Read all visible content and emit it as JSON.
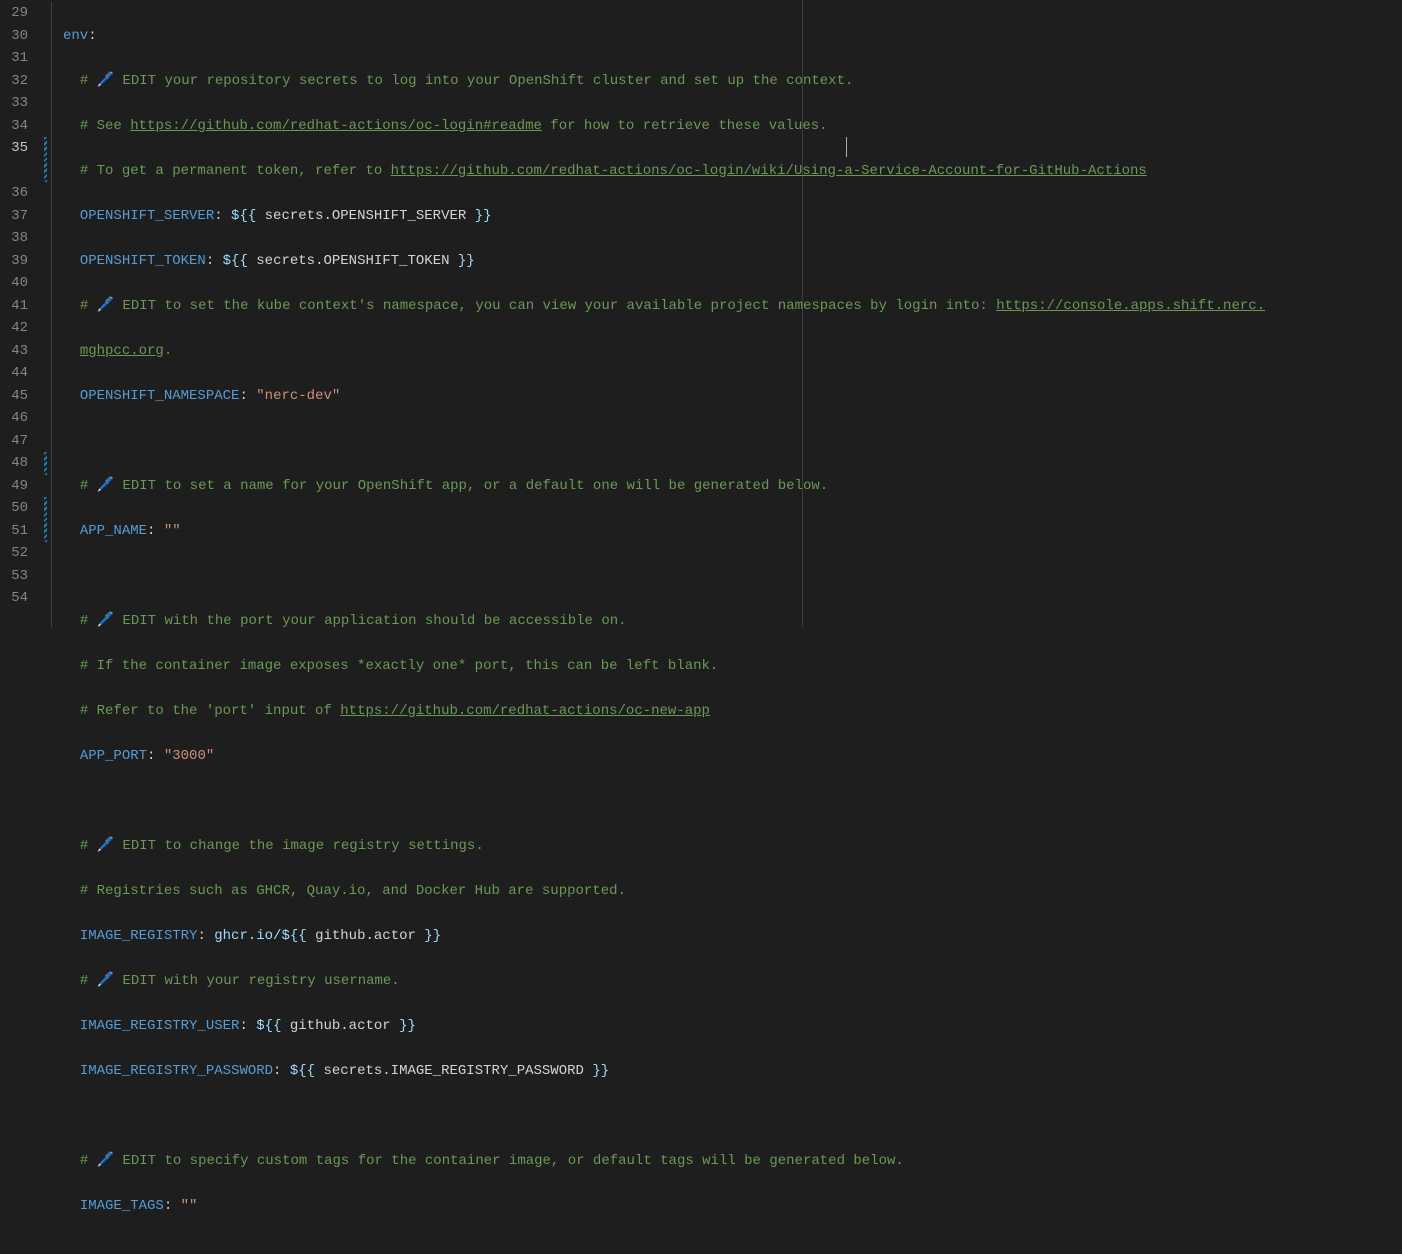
{
  "lineNumbers": [
    "29",
    "30",
    "31",
    "32",
    "33",
    "34",
    "35",
    "",
    "36",
    "37",
    "38",
    "39",
    "40",
    "41",
    "42",
    "43",
    "44",
    "45",
    "46",
    "47",
    "48",
    "49",
    "50",
    "51",
    "52",
    "53",
    "54"
  ],
  "activeLine": 6,
  "changeMarks": [
    6,
    7,
    20,
    22,
    23
  ],
  "indentStart": 1,
  "code": {
    "l29": {
      "kw": "env",
      "p": ":"
    },
    "l30": {
      "hash": "# ",
      "edit": "🖊️ EDIT your repository secrets to log into your OpenShift cluster and set up the context."
    },
    "l31": {
      "hash": "# See ",
      "link": "https://github.com/redhat-actions/oc-login#readme",
      "rest": " for how to retrieve these values."
    },
    "l32": {
      "hash": "# To get a permanent token, refer to ",
      "link": "https://github.com/redhat-actions/oc-login/wiki/Using-a-Service-Account-for-GitHub-Actions"
    },
    "l33": {
      "key": "OPENSHIFT_SERVER",
      "p": ": ",
      "e1": "${{ ",
      "e2": "secrets.OPENSHIFT_SERVER",
      "e3": " }}"
    },
    "l34": {
      "key": "OPENSHIFT_TOKEN",
      "p": ": ",
      "e1": "${{ ",
      "e2": "secrets.OPENSHIFT_TOKEN",
      "e3": " }}"
    },
    "l35a": {
      "hash": "# ",
      "edit": "🖊️ EDIT to set the kube context's namespace, you can view your available project namespaces by login into: ",
      "link": "https://console.apps.shift.nerc."
    },
    "l35b": {
      "link": "mghpcc.org",
      "rest": "."
    },
    "l36": {
      "key": "OPENSHIFT_NAMESPACE",
      "p": ": ",
      "str": "\"nerc-dev\""
    },
    "l38": {
      "hash": "# ",
      "edit": "🖊️ EDIT to set a name for your OpenShift app, or a default one will be generated below."
    },
    "l39": {
      "key": "APP_NAME",
      "p": ": ",
      "str": "\"\""
    },
    "l41": {
      "hash": "# ",
      "edit": "🖊️ EDIT with the port your application should be accessible on."
    },
    "l42": {
      "hash": "# If the container image exposes *exactly one* port, this can be left blank."
    },
    "l43": {
      "hash": "# Refer to the 'port' input of ",
      "link": "https://github.com/redhat-actions/oc-new-app"
    },
    "l44": {
      "key": "APP_PORT",
      "p": ": ",
      "str": "\"3000\""
    },
    "l46": {
      "hash": "# ",
      "edit": "🖊️ EDIT to change the image registry settings."
    },
    "l47": {
      "hash": "# Registries such as GHCR, Quay.io, and Docker Hub are supported."
    },
    "l48": {
      "key": "IMAGE_REGISTRY",
      "p": ": ",
      "v1": "ghcr.io/",
      "e1": "${{ ",
      "e2": "github.actor",
      "e3": " }}"
    },
    "l49": {
      "hash": "# ",
      "edit": "🖊️ EDIT with your registry username."
    },
    "l50": {
      "key": "IMAGE_REGISTRY_USER",
      "p": ": ",
      "e1": "${{ ",
      "e2": "github.actor",
      "e3": " }}"
    },
    "l51": {
      "key": "IMAGE_REGISTRY_PASSWORD",
      "p": ": ",
      "e1": "${{ ",
      "e2": "secrets.IMAGE_REGISTRY_PASSWORD",
      "e3": " }}"
    },
    "l53": {
      "hash": "# ",
      "edit": "🖊️ EDIT to specify custom tags for the container image, or default tags will be generated below."
    },
    "l54": {
      "key": "IMAGE_TAGS",
      "p": ": ",
      "str": "\"\""
    }
  }
}
